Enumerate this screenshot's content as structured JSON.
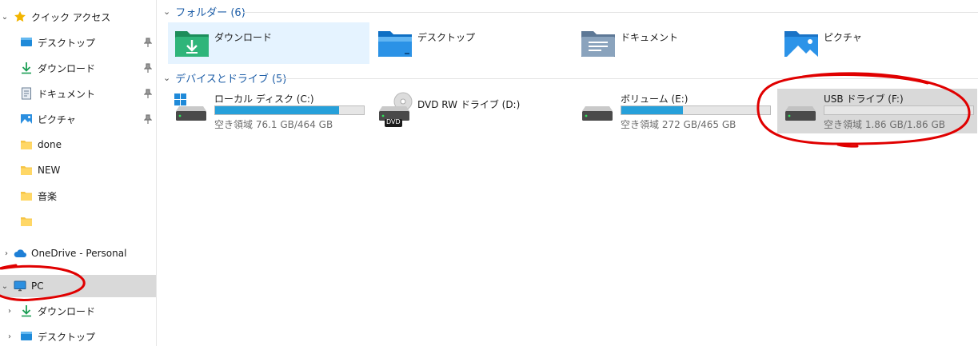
{
  "sidebar": {
    "items": [
      {
        "label": "クイック アクセス",
        "icon": "star-icon"
      },
      {
        "label": "デスクトップ",
        "icon": "desktop-folder-icon"
      },
      {
        "label": "ダウンロード",
        "icon": "download-arrow-icon"
      },
      {
        "label": "ドキュメント",
        "icon": "document-icon"
      },
      {
        "label": "ピクチャ",
        "icon": "pictures-icon"
      },
      {
        "label": "done",
        "icon": "folder-icon"
      },
      {
        "label": "NEW",
        "icon": "folder-icon"
      },
      {
        "label": "音楽",
        "icon": "folder-icon"
      },
      {
        "label": "",
        "icon": "folder-icon"
      },
      {
        "label": "OneDrive - Personal",
        "icon": "cloud-icon"
      },
      {
        "label": "PC",
        "icon": "monitor-icon"
      },
      {
        "label": "ダウンロード",
        "icon": "download-arrow-icon"
      },
      {
        "label": "デスクトップ",
        "icon": "desktop-folder-icon"
      }
    ]
  },
  "main": {
    "folders_header": "フォルダー (6)",
    "devices_header": "デバイスとドライブ (5)",
    "folders": [
      {
        "name": "ダウンロード",
        "icon": "downloads-folder-icon"
      },
      {
        "name": "デスクトップ",
        "icon": "desktop-folder-icon"
      },
      {
        "name": "ドキュメント",
        "icon": "documents-folder-icon"
      },
      {
        "name": "ピクチャ",
        "icon": "pictures-folder-icon"
      }
    ],
    "drives": [
      {
        "name": "ローカル ディスク (C:)",
        "free": "空き領域 76.1 GB/464 GB",
        "used_fraction": 0.836,
        "icon": "windows-drive-icon"
      },
      {
        "name": "DVD RW ドライブ (D:)",
        "free": "",
        "icon": "dvd-drive-icon",
        "dvd_badge": "DVD"
      },
      {
        "name": "ボリューム (E:)",
        "free": "空き領域 272 GB/465 GB",
        "used_fraction": 0.415,
        "icon": "hard-drive-icon"
      },
      {
        "name": "USB ドライブ (F:)",
        "free": "空き領域 1.86 GB/1.86 GB",
        "used_fraction": 0.0,
        "icon": "usb-drive-icon"
      }
    ]
  },
  "colors": {
    "accent": "#26a0da",
    "header_blue": "#1f5fa8",
    "annotation_red": "#e00000",
    "selected": "#e5f3ff",
    "hover": "#d9d9d9"
  }
}
